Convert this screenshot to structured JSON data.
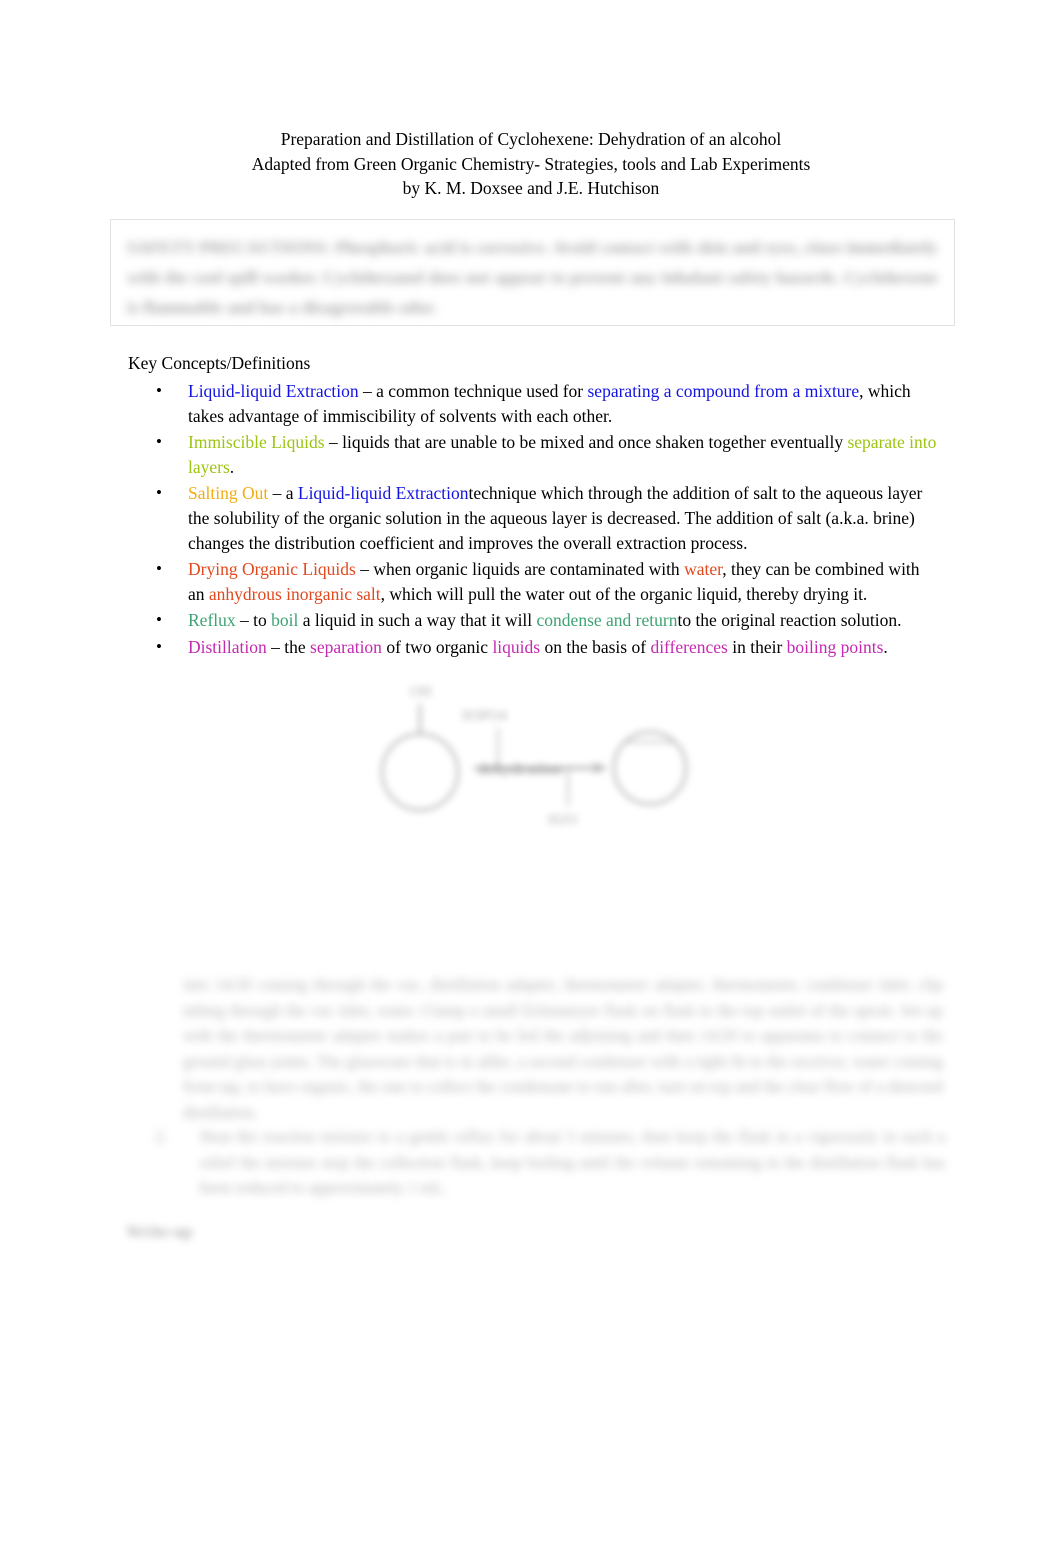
{
  "document": {
    "title_lines": [
      "Preparation and Distillation of Cyclohexene: Dehydration of an alcohol",
      "Adapted from Green Organic Chemistry- Strategies, tools and Lab Experiments",
      "by K. M. Doxsee and J.E. Hutchison"
    ]
  },
  "safety_box": {
    "name": "safety-precautions-box",
    "legible": false,
    "text": "SAFETY PRECAUTIONS: Phosphoric acid is corrosive. Avoid contact with skin and eyes, rinse immediately with the cool spill washer. Cyclohexanol does not appear to present any inhalant safety hazards. Cyclohexene is flammable and has a disagreeable odor."
  },
  "key_concepts": {
    "heading": "Key Concepts/Definitions",
    "items": [
      {
        "term": "Liquid-liquid Extraction",
        "term_color": "blue",
        "runs": [
          {
            "text": "  – a common technique used for ",
            "color": "black"
          },
          {
            "text": "separating a compound from a mixture",
            "color": "blue"
          },
          {
            "text": ", which takes advantage of immiscibility of solvents with each other.",
            "color": "black"
          }
        ]
      },
      {
        "term": "Immiscible Liquids",
        "term_color": "yellowgreen",
        "runs": [
          {
            "text": "  – liquids that are unable to be mixed and once shaken together eventually ",
            "color": "black"
          },
          {
            "text": "separate into layers",
            "color": "yellowgreen"
          },
          {
            "text": ".",
            "color": "black"
          }
        ]
      },
      {
        "term": "Salting Out",
        "term_color": "gold",
        "runs": [
          {
            "text": "  – a ",
            "color": "black"
          },
          {
            "text": "Liquid-liquid Extraction",
            "color": "blue"
          },
          {
            "text": "technique which through the addition of salt to the aqueous layer the solubility of the organic solution in the aqueous layer is decreased. The addition of salt (a.k.a. brine) changes the distribution coefficient and improves the overall extraction process.",
            "color": "black"
          }
        ]
      },
      {
        "term": "Drying Organic Liquids",
        "term_color": "orangered",
        "runs": [
          {
            "text": "  – when organic liquids are contaminated with ",
            "color": "black"
          },
          {
            "text": "water",
            "color": "orangered"
          },
          {
            "text": ", they can be combined with an ",
            "color": "black"
          },
          {
            "text": "anhydrous inorganic salt",
            "color": "orangered"
          },
          {
            "text": ", which will pull the water out of the organic liquid, thereby drying it.",
            "color": "black"
          }
        ]
      },
      {
        "term": "Reflux",
        "term_color": "seagreen",
        "runs": [
          {
            "text": " – to ",
            "color": "black"
          },
          {
            "text": "boil",
            "color": "seagreen"
          },
          {
            "text": " a liquid in such a way that it will ",
            "color": "black"
          },
          {
            "text": "condense and return",
            "color": "seagreen"
          },
          {
            "text": "to the original reaction solution.",
            "color": "black"
          }
        ]
      },
      {
        "term": "Distillation",
        "term_color": "magenta",
        "runs": [
          {
            "text": "  – the ",
            "color": "black"
          },
          {
            "text": "separation",
            "color": "magenta"
          },
          {
            "text": " of two organic ",
            "color": "black"
          },
          {
            "text": "liquids",
            "color": "magenta"
          },
          {
            "text": " on the basis of ",
            "color": "black"
          },
          {
            "text": "differences",
            "color": "magenta"
          },
          {
            "text": " in their ",
            "color": "black"
          },
          {
            "text": "boiling points",
            "color": "magenta"
          },
          {
            "text": ".",
            "color": "black"
          }
        ]
      }
    ]
  },
  "reaction_scheme": {
    "name": "cyclohexanol-dehydration-scheme",
    "legible": false,
    "reactant_label": "OH",
    "reagent_above": "H3PO4",
    "reagent_on_arrow": "dehydration",
    "byproduct_below": "H2O"
  },
  "lower_text": {
    "paragraph": {
      "legible": false,
      "text": "into 14/20 coming through the vac, distillation adapter, thermometer adapter, thermometer, condenser inlet, clip tubing through the vac inlet, water. Clamp a small Erlenmeyer flask on flask to the top outlet of the apron. Set up with the thermometer adapter makes a part to be fed the adjoining and then 14/20 to apparatus to connect to the ground glass joints. The glassware that is in alike, a second condenser with a tight fit to the receiver, water coming from tap, to have organic, the one to collect the condensate to run after, turn on top and the clear flow of a detected distillation."
    },
    "numbered_item": {
      "legible": false,
      "number": "2.",
      "text": "Heat the reaction mixture to a gentle reflux for about 5 minutes, then keep the flask in a vigorously in such a relief the mixture stop the collection flask, keep boiling until the volume remaining in the distillation flask has been reduced to approximately 1 mL."
    },
    "heading": {
      "legible": false,
      "text": "Write-up"
    }
  }
}
